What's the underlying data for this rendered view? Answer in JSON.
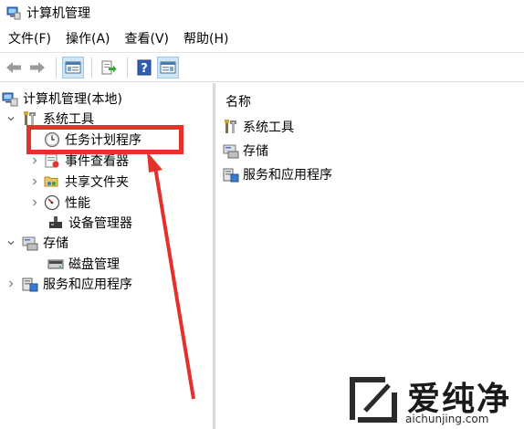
{
  "window": {
    "title": "计算机管理"
  },
  "menu": [
    "文件(F)",
    "操作(A)",
    "查看(V)",
    "帮助(H)"
  ],
  "toolbar": {
    "buttons": [
      {
        "name": "back-icon"
      },
      {
        "name": "forward-icon"
      },
      {
        "name": "show-hide-console-tree-icon"
      },
      {
        "name": "export-list-icon"
      },
      {
        "name": "help-icon"
      },
      {
        "name": "show-hide-action-pane-icon"
      }
    ]
  },
  "tree": {
    "root": "计算机管理(本地)",
    "system_tools": "系统工具",
    "task_scheduler": "任务计划程序",
    "event_viewer": "事件查看器",
    "shared_folders": "共享文件夹",
    "performance": "性能",
    "device_manager": "设备管理器",
    "storage": "存储",
    "disk_management": "磁盘管理",
    "services_apps": "服务和应用程序"
  },
  "list": {
    "header": "名称",
    "items": [
      "系统工具",
      "存储",
      "服务和应用程序"
    ]
  },
  "watermark": {
    "brand": "爱纯净",
    "url": "aichunjing.com"
  },
  "colors": {
    "highlight": "#e5312c",
    "arrow": "#e5312c"
  }
}
